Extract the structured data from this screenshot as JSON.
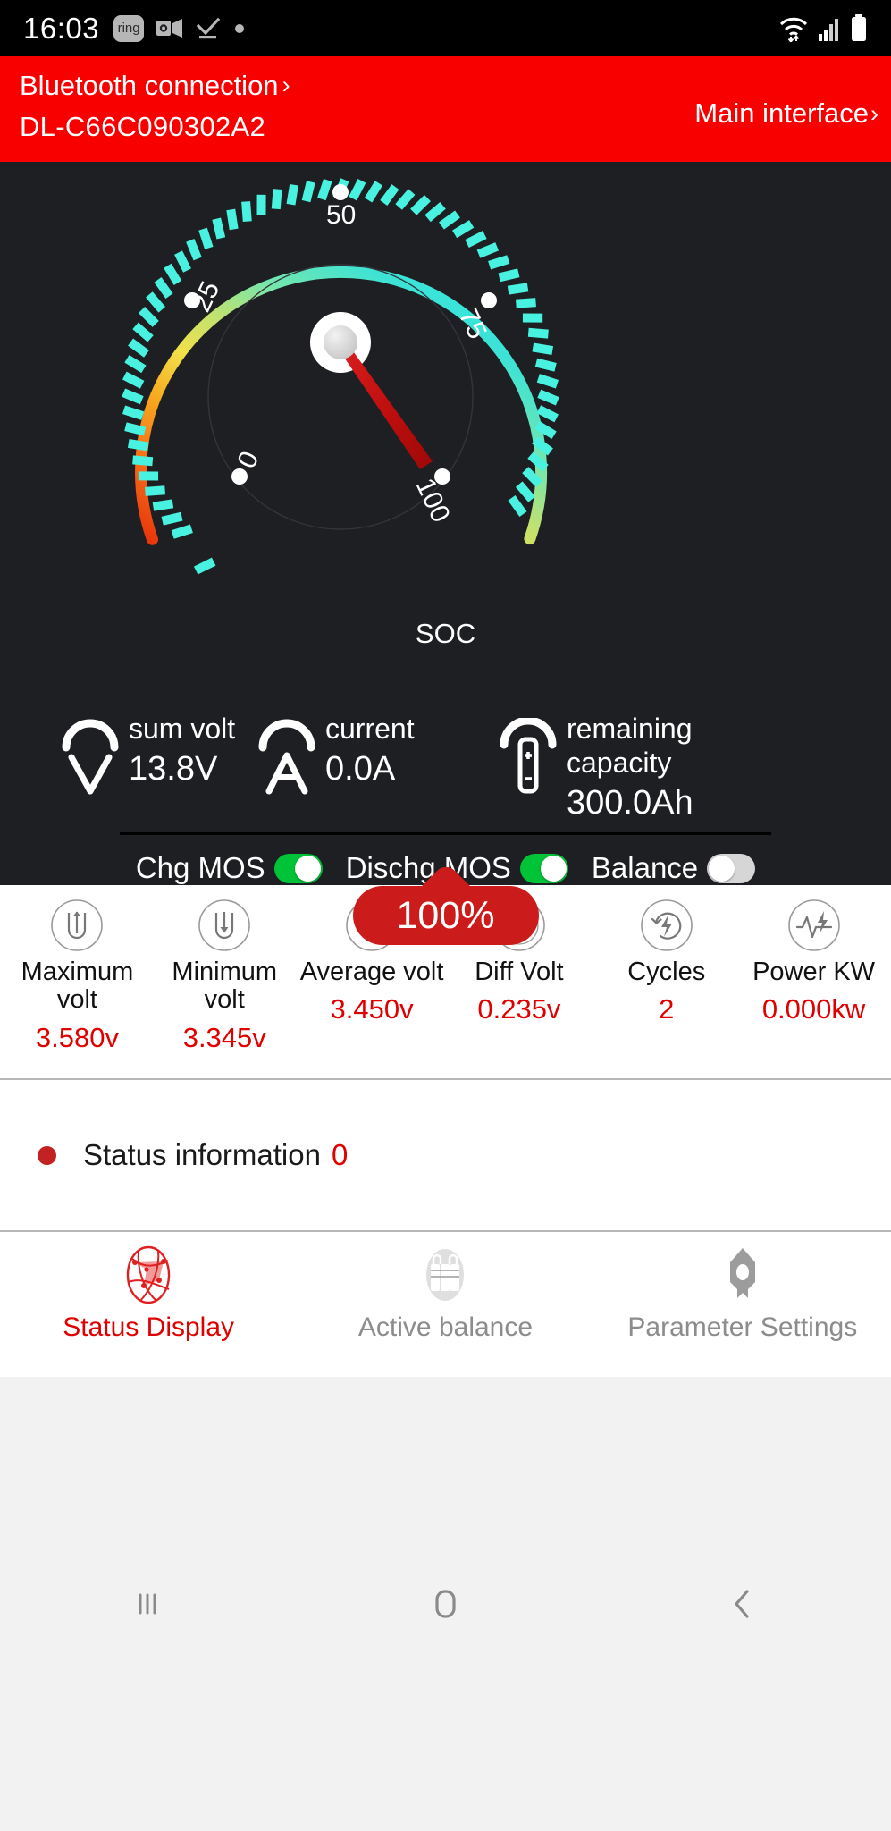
{
  "statusbar": {
    "clock": "16:03",
    "icons": [
      "ring-badge-icon",
      "outlook-icon",
      "checkmark-icon",
      "dot-icon"
    ],
    "right_icons": [
      "wifi-icon",
      "cellular-signal-icon",
      "battery-icon"
    ],
    "ring_label": "ring"
  },
  "appbar": {
    "bluetooth_label": "Bluetooth connection",
    "bluetooth_chevron": "›",
    "device_name": "DL-C66C090302A2",
    "main_interface_label": "Main interface",
    "main_interface_chevron": "›",
    "bg_color": "#f90000"
  },
  "gauge": {
    "center_label": "SOC",
    "percent_text": "100%",
    "tick_labels": [
      "0",
      "25",
      "50",
      "75",
      "100"
    ],
    "value": 100,
    "min": 0,
    "max": 100,
    "needle_color": "#c81414",
    "badge_color": "#cc1b1b",
    "tick_color": "#49f2e0",
    "arc_colors": [
      "#e8340c",
      "#f58220",
      "#f5d020",
      "#c9e265",
      "#7ee8a8",
      "#3ae0d0",
      "#2ee6e0"
    ]
  },
  "stats": [
    {
      "icon": "voltmeter-icon",
      "name": "sum volt",
      "value": "13.8V"
    },
    {
      "icon": "ammeter-icon",
      "name": "current",
      "value": "0.0A"
    },
    {
      "icon": "battery-capacity-icon",
      "name": "remaining capacity",
      "value": "300.0Ah"
    }
  ],
  "mos": [
    {
      "label": "Chg MOS",
      "state": "on"
    },
    {
      "label": "Dischg MOS",
      "state": "on"
    },
    {
      "label": "Balance",
      "state": "off"
    }
  ],
  "metrics": [
    {
      "icon": "arrow-up-in-u-icon",
      "label": "Maximum volt",
      "value": "3.580v"
    },
    {
      "icon": "arrow-down-in-u-icon",
      "label": "Minimum volt",
      "value": "3.345v"
    },
    {
      "icon": "sine-wave-icon",
      "label": "Average volt",
      "value": "3.450v"
    },
    {
      "icon": "pressure-gauge-icon",
      "label": "Diff Volt",
      "value": "0.235v"
    },
    {
      "icon": "recycle-bolt-icon",
      "label": "Cycles",
      "value": "2"
    },
    {
      "icon": "pulse-bolt-icon",
      "label": "Power KW",
      "value": "0.000kw"
    }
  ],
  "status_info": {
    "label": "Status information",
    "count": "0",
    "dot_color": "#c32222"
  },
  "tabs": [
    {
      "icon": "network-globe-icon",
      "label": "Status Display",
      "active": true
    },
    {
      "icon": "battery-cells-icon",
      "label": "Active balance",
      "active": false
    },
    {
      "icon": "rocket-gear-icon",
      "label": "Parameter Settings",
      "active": false
    }
  ],
  "navbar": {
    "recents": "recents-icon",
    "home": "home-icon",
    "back": "back-icon"
  }
}
